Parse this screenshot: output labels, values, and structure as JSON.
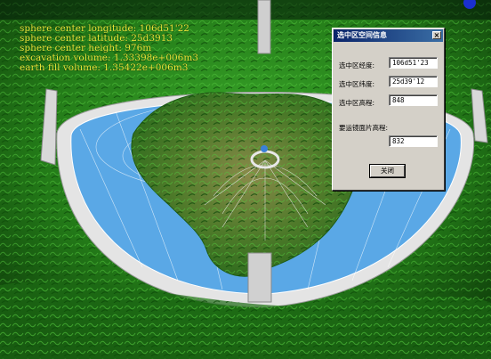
{
  "overlay": {
    "line1": "sphere center longitude: 106d51'22",
    "line2": "sphere center latitude: 25d3913",
    "line3": "sphere center height: 976m",
    "line4": "excavation volume: 1.33398e+006m3",
    "line5": "earth fill volume: 1.35422e+006m3"
  },
  "dialog": {
    "title": "选中区空间信息",
    "close_glyph": "×",
    "longitude_label": "选中区经度:",
    "longitude_value": "106d51'23",
    "latitude_label": "选中区纬度:",
    "latitude_value": "25d39'12",
    "height_label": "选中区高程:",
    "height_value": "848",
    "mirror_label": "要运镜面片高程:",
    "mirror_value": "832",
    "close_button": "关闭"
  },
  "colors": {
    "terrain_green": "#2f8f1e",
    "dish_blue": "#5aa8e6",
    "ring_gray": "#d8d8d8",
    "overlay_text": "#e8ec3a",
    "titlebar": "#0a246a"
  }
}
